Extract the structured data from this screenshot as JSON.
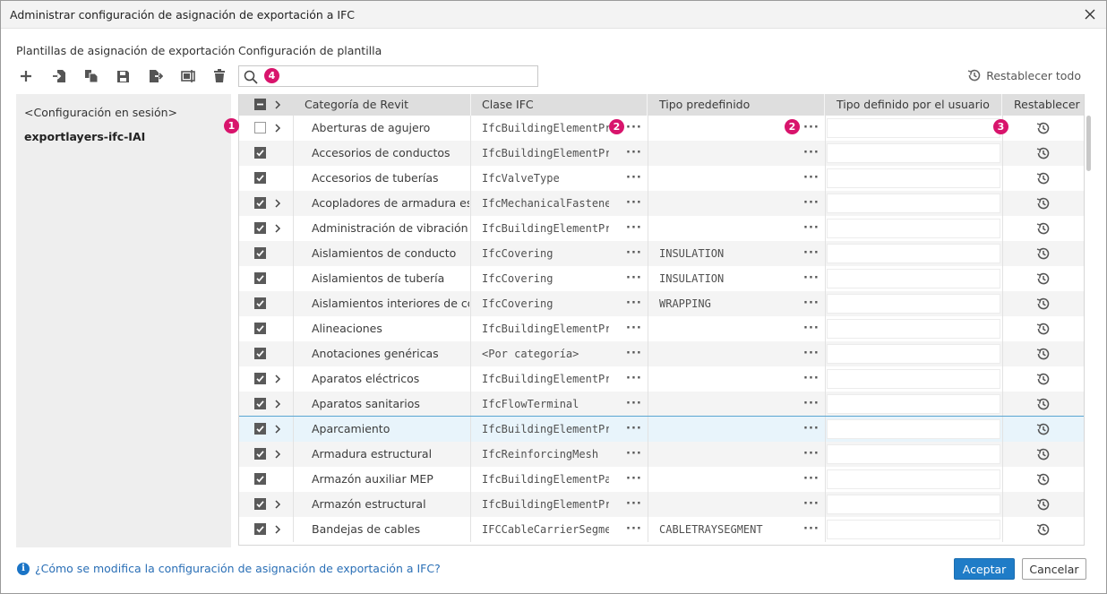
{
  "window": {
    "title": "Administrar configuración de asignación de exportación a IFC"
  },
  "left_panel": {
    "heading": "Plantillas de asignación de exportación",
    "toolbar": [
      {
        "name": "add-template-button",
        "icon": "plus-icon"
      },
      {
        "name": "import-button",
        "icon": "import-icon"
      },
      {
        "name": "duplicate-button",
        "icon": "duplicate-icon"
      },
      {
        "name": "save-button",
        "icon": "save-icon"
      },
      {
        "name": "export-button",
        "icon": "export-icon"
      },
      {
        "name": "rename-button",
        "icon": "rename-icon"
      },
      {
        "name": "delete-button",
        "icon": "trash-icon"
      }
    ],
    "templates": [
      "<Configuración en sesión>",
      "exportlayers-ifc-IAI"
    ]
  },
  "right_panel": {
    "heading": "Configuración de plantilla",
    "search": {
      "value": "",
      "placeholder": ""
    },
    "reset_all": "Restablecer todo"
  },
  "badges": [
    "1",
    "2",
    "2",
    "3",
    "4"
  ],
  "grid": {
    "columns": [
      "Categoría de Revit",
      "Clase IFC",
      "Tipo predefinido",
      "Tipo definido por el usuario",
      "Restablecer"
    ],
    "rows": [
      {
        "category": "Aberturas de agujero",
        "ifc": "IfcBuildingElementProxy",
        "predef": "",
        "user": "",
        "checked": false,
        "expand": true
      },
      {
        "category": "Accesorios de conductos",
        "ifc": "IfcBuildingElementProxy",
        "predef": "",
        "user": "",
        "checked": true,
        "expand": false
      },
      {
        "category": "Accesorios de tuberías",
        "ifc": "IfcValveType",
        "predef": "",
        "user": "",
        "checked": true,
        "expand": false
      },
      {
        "category": "Acopladores de armadura estructural",
        "ifc": "IfcMechanicalFastener",
        "predef": "",
        "user": "",
        "checked": true,
        "expand": true
      },
      {
        "category": "Administración de vibración",
        "ifc": "IfcBuildingElementProxy",
        "predef": "",
        "user": "",
        "checked": true,
        "expand": true
      },
      {
        "category": "Aislamientos de conducto",
        "ifc": "IfcCovering",
        "predef": "INSULATION",
        "user": "",
        "checked": true,
        "expand": false
      },
      {
        "category": "Aislamientos de tubería",
        "ifc": "IfcCovering",
        "predef": "INSULATION",
        "user": "",
        "checked": true,
        "expand": false
      },
      {
        "category": "Aislamientos interiores de conducto",
        "ifc": "IfcCovering",
        "predef": "WRAPPING",
        "user": "",
        "checked": true,
        "expand": false
      },
      {
        "category": "Alineaciones",
        "ifc": "IfcBuildingElementProxy",
        "predef": "",
        "user": "",
        "checked": true,
        "expand": false
      },
      {
        "category": "Anotaciones genéricas",
        "ifc": "<Por categoría>",
        "predef": "",
        "user": "",
        "checked": true,
        "expand": false
      },
      {
        "category": "Aparatos eléctricos",
        "ifc": "IfcBuildingElementProxy",
        "predef": "",
        "user": "",
        "checked": true,
        "expand": true
      },
      {
        "category": "Aparatos sanitarios",
        "ifc": "IfcFlowTerminal",
        "predef": "",
        "user": "",
        "checked": true,
        "expand": true
      },
      {
        "category": "Aparcamiento",
        "ifc": "IfcBuildingElementProxy",
        "predef": "",
        "user": "",
        "checked": true,
        "expand": true,
        "selected": true
      },
      {
        "category": "Armadura estructural",
        "ifc": "IfcReinforcingMesh",
        "predef": "",
        "user": "",
        "checked": true,
        "expand": true
      },
      {
        "category": "Armazón auxiliar MEP",
        "ifc": "IfcBuildingElementPart",
        "predef": "",
        "user": "",
        "checked": true,
        "expand": false
      },
      {
        "category": "Armazón estructural",
        "ifc": "IfcBuildingElementProxy",
        "predef": "",
        "user": "",
        "checked": true,
        "expand": true
      },
      {
        "category": "Bandejas de cables",
        "ifc": "IFCCableCarrierSegment",
        "predef": "CABLETRAYSEGMENT",
        "user": "",
        "checked": true,
        "expand": true
      }
    ]
  },
  "footer": {
    "help_link": "¿Cómo se modifica la configuración de asignación de exportación a IFC?",
    "accept": "Aceptar",
    "cancel": "Cancelar"
  },
  "colors": {
    "accent": "#1f7cc7",
    "badge": "#d8146c",
    "selected_row": "#e8f4fb",
    "header": "#dedede"
  }
}
